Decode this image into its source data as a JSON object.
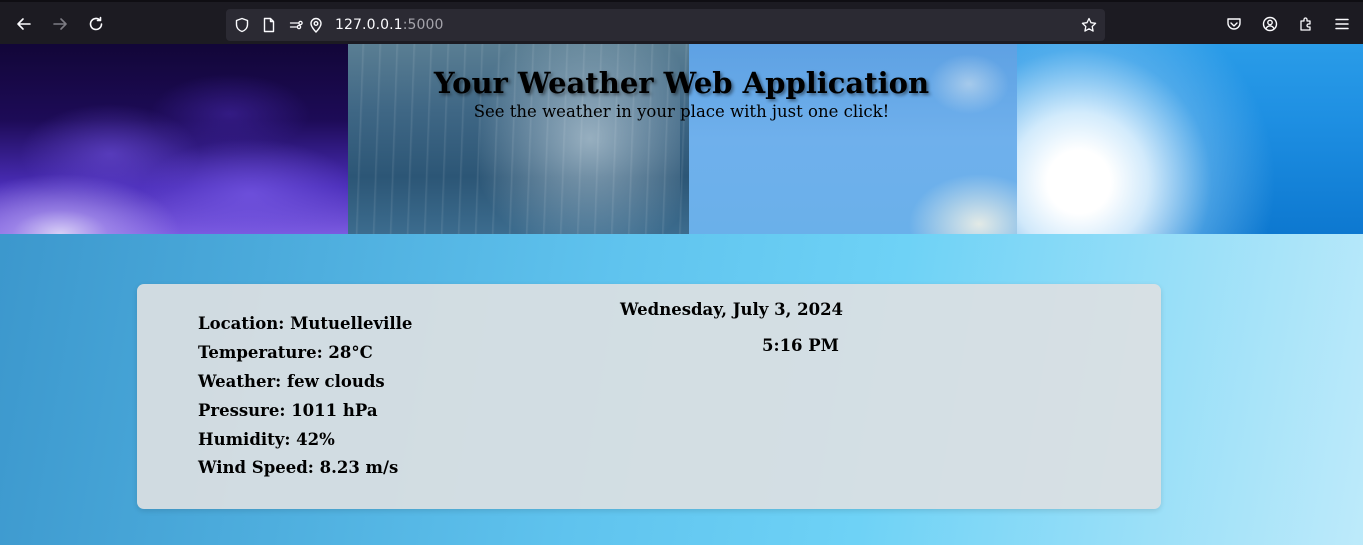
{
  "browser": {
    "url_host": "127.0.0.1",
    "url_port": ":5000"
  },
  "banner": {
    "title": "Your Weather Web Application",
    "subtitle": "See the weather in your place with just one click!"
  },
  "weather": {
    "location": "Location: Mutuelleville",
    "temperature": "Temperature: 28°C",
    "condition": "Weather: few clouds",
    "pressure": "Pressure: 1011 hPa",
    "humidity": "Humidity: 42%",
    "wind_speed": "Wind Speed: 8.23 m/s",
    "date": "Wednesday, July 3, 2024",
    "time": "5:16 PM"
  }
}
